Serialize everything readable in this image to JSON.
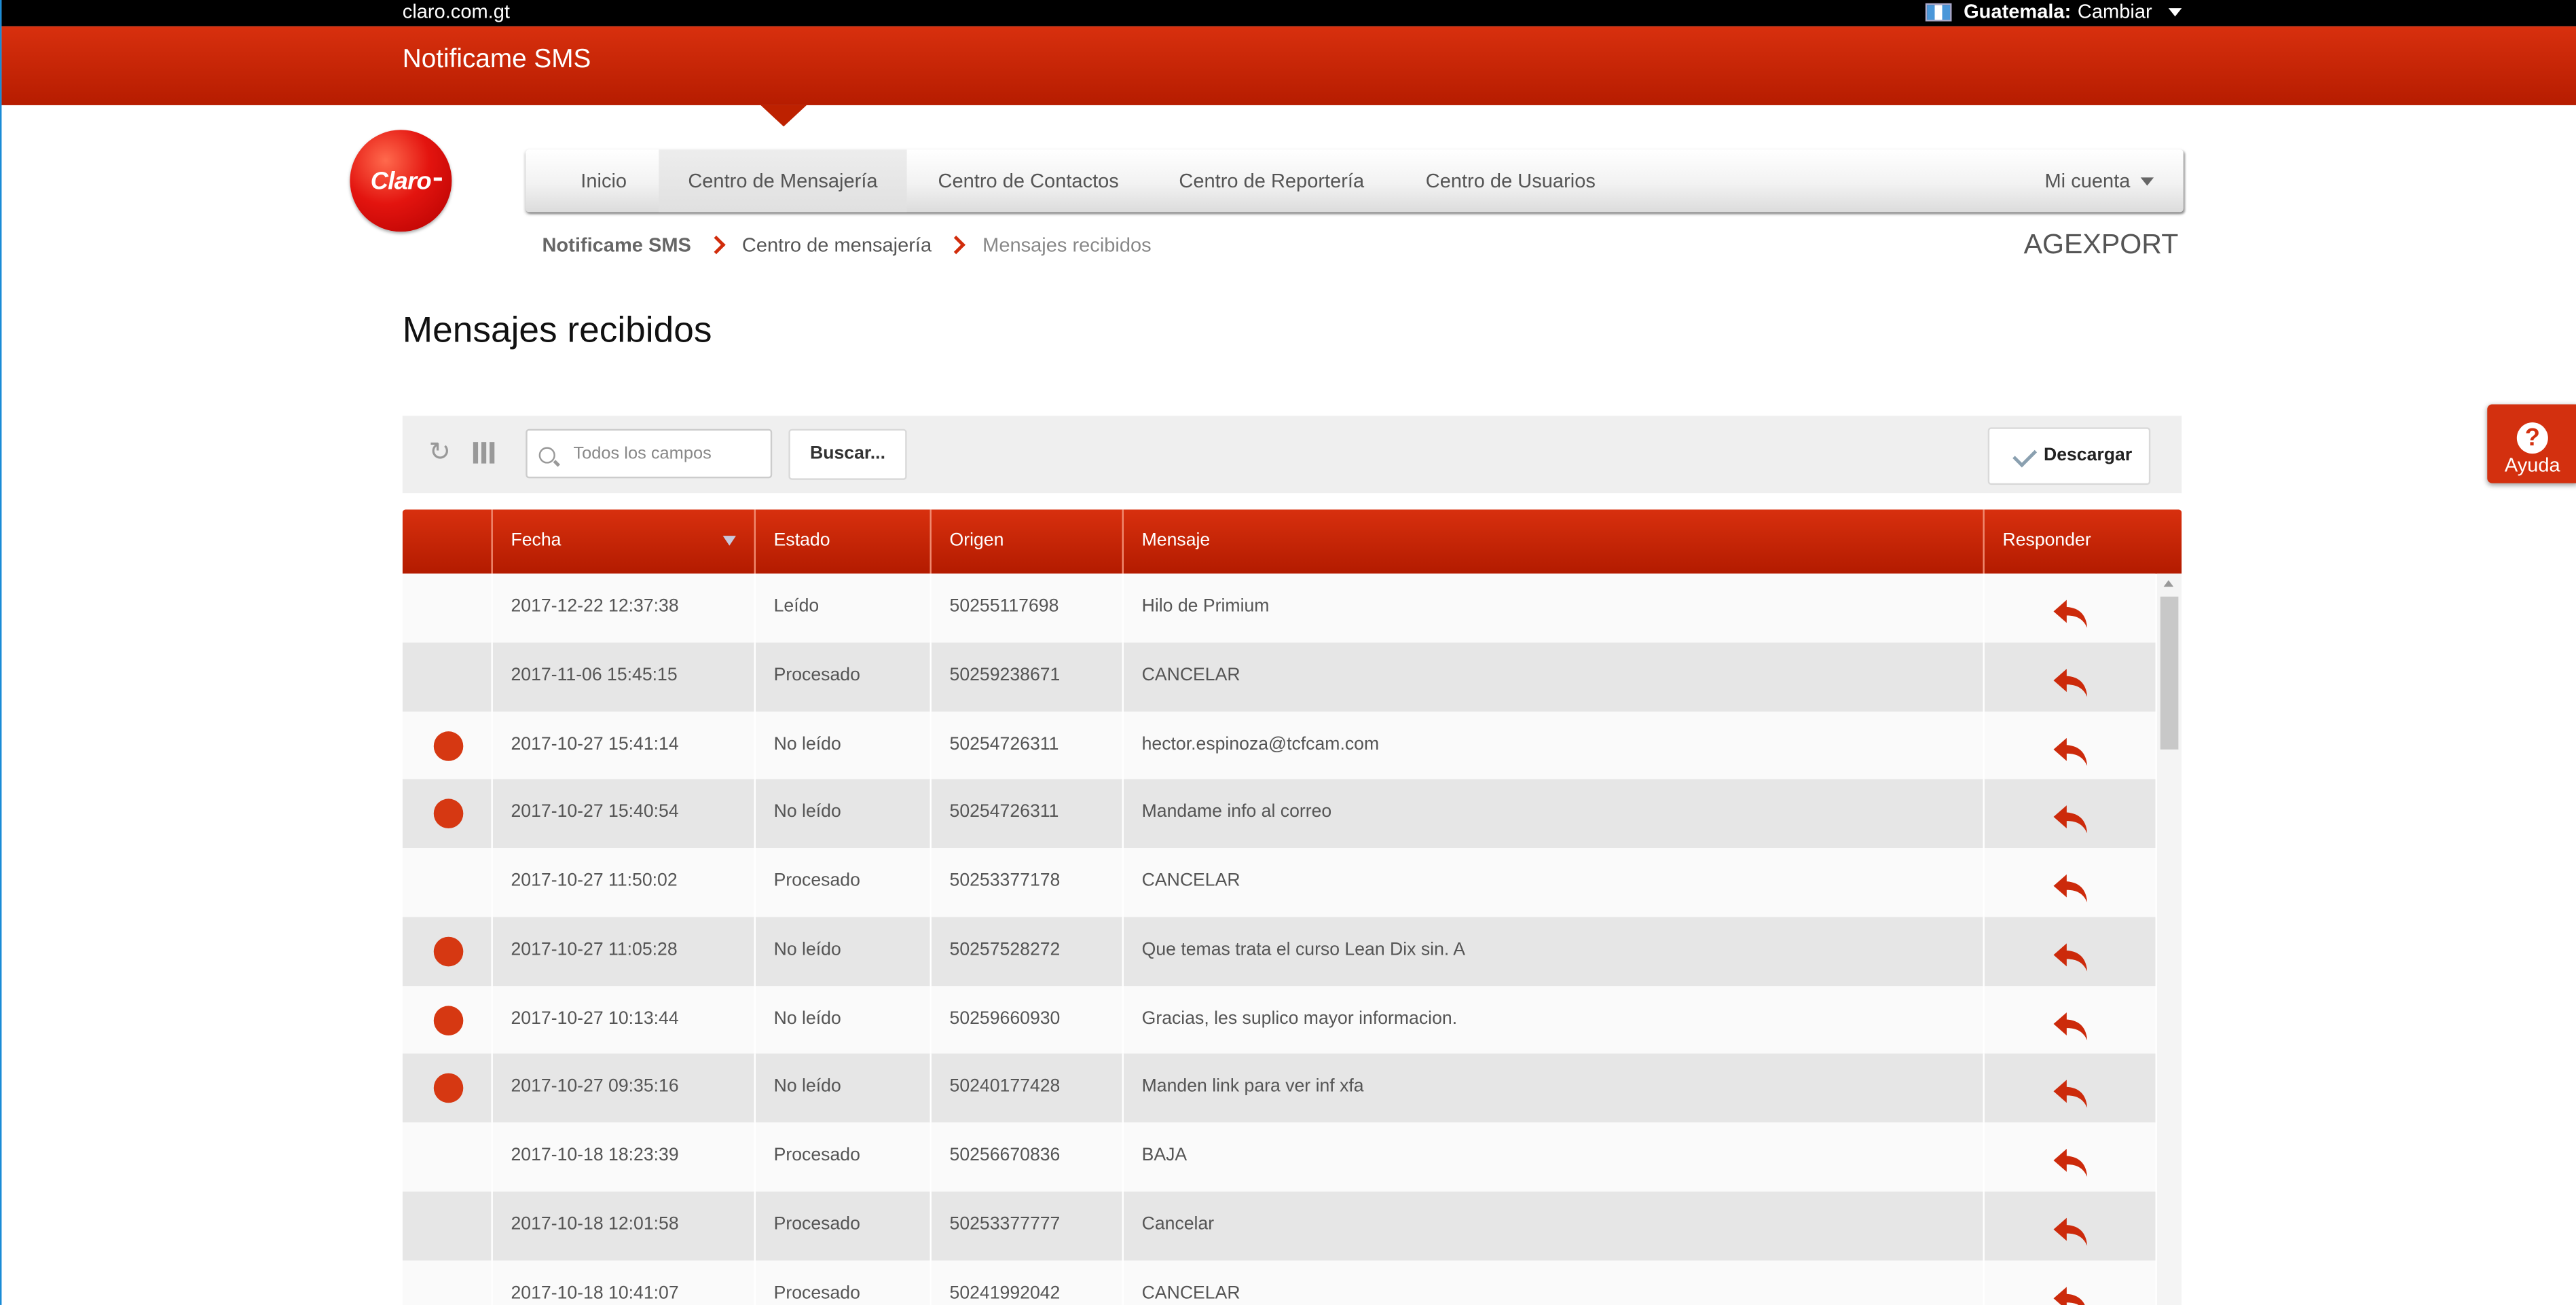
{
  "topbar": {
    "site": "claro.com.gt",
    "country_label": "Guatemala:",
    "change_label": "Cambiar"
  },
  "header": {
    "app_title": "Notificame SMS"
  },
  "logo": {
    "text": "Claro"
  },
  "nav": {
    "items": [
      {
        "label": "Inicio",
        "active": false
      },
      {
        "label": "Centro de Mensajería",
        "active": true
      },
      {
        "label": "Centro de Contactos",
        "active": false
      },
      {
        "label": "Centro de Reportería",
        "active": false
      },
      {
        "label": "Centro de Usuarios",
        "active": false
      }
    ],
    "account_label": "Mi cuenta"
  },
  "breadcrumb": {
    "root": "Notificame SMS",
    "section": "Centro de mensajería",
    "current": "Mensajes recibidos"
  },
  "company": "AGEXPORT",
  "page_title": "Mensajes recibidos",
  "toolbar": {
    "search_placeholder": "Todos los campos",
    "search_button": "Buscar...",
    "download_button": "Descargar"
  },
  "table": {
    "columns": [
      "",
      "Fecha",
      "Estado",
      "Origen",
      "Mensaje",
      "Responder"
    ],
    "rows": [
      {
        "unread": false,
        "fecha": "2017-12-22 12:37:38",
        "estado": "Leído",
        "origen": "50255117698",
        "mensaje": "Hilo de Primium"
      },
      {
        "unread": false,
        "fecha": "2017-11-06 15:45:15",
        "estado": "Procesado",
        "origen": "50259238671",
        "mensaje": "CANCELAR"
      },
      {
        "unread": true,
        "fecha": "2017-10-27 15:41:14",
        "estado": "No leído",
        "origen": "50254726311",
        "mensaje": "hector.espinoza@tcfcam.com"
      },
      {
        "unread": true,
        "fecha": "2017-10-27 15:40:54",
        "estado": "No leído",
        "origen": "50254726311",
        "mensaje": "Mandame info al correo"
      },
      {
        "unread": false,
        "fecha": "2017-10-27 11:50:02",
        "estado": "Procesado",
        "origen": "50253377178",
        "mensaje": "CANCELAR"
      },
      {
        "unread": true,
        "fecha": "2017-10-27 11:05:28",
        "estado": "No leído",
        "origen": "50257528272",
        "mensaje": "Que temas trata el curso Lean Dix sin. A"
      },
      {
        "unread": true,
        "fecha": "2017-10-27 10:13:44",
        "estado": "No leído",
        "origen": "50259660930",
        "mensaje": "Gracias, les suplico mayor informacion."
      },
      {
        "unread": true,
        "fecha": "2017-10-27 09:35:16",
        "estado": "No leído",
        "origen": "50240177428",
        "mensaje": "Manden link para ver inf xfa"
      },
      {
        "unread": false,
        "fecha": "2017-10-18 18:23:39",
        "estado": "Procesado",
        "origen": "50256670836",
        "mensaje": "BAJA"
      },
      {
        "unread": false,
        "fecha": "2017-10-18 12:01:58",
        "estado": "Procesado",
        "origen": "50253377777",
        "mensaje": "Cancelar"
      },
      {
        "unread": false,
        "fecha": "2017-10-18 10:41:07",
        "estado": "Procesado",
        "origen": "50241992042",
        "mensaje": "CANCELAR"
      }
    ]
  },
  "help": {
    "label": "Ayuda"
  },
  "colors": {
    "brand_red": "#d12c0b",
    "header_red_dark": "#b61c00",
    "unread_dot": "#d63812"
  }
}
